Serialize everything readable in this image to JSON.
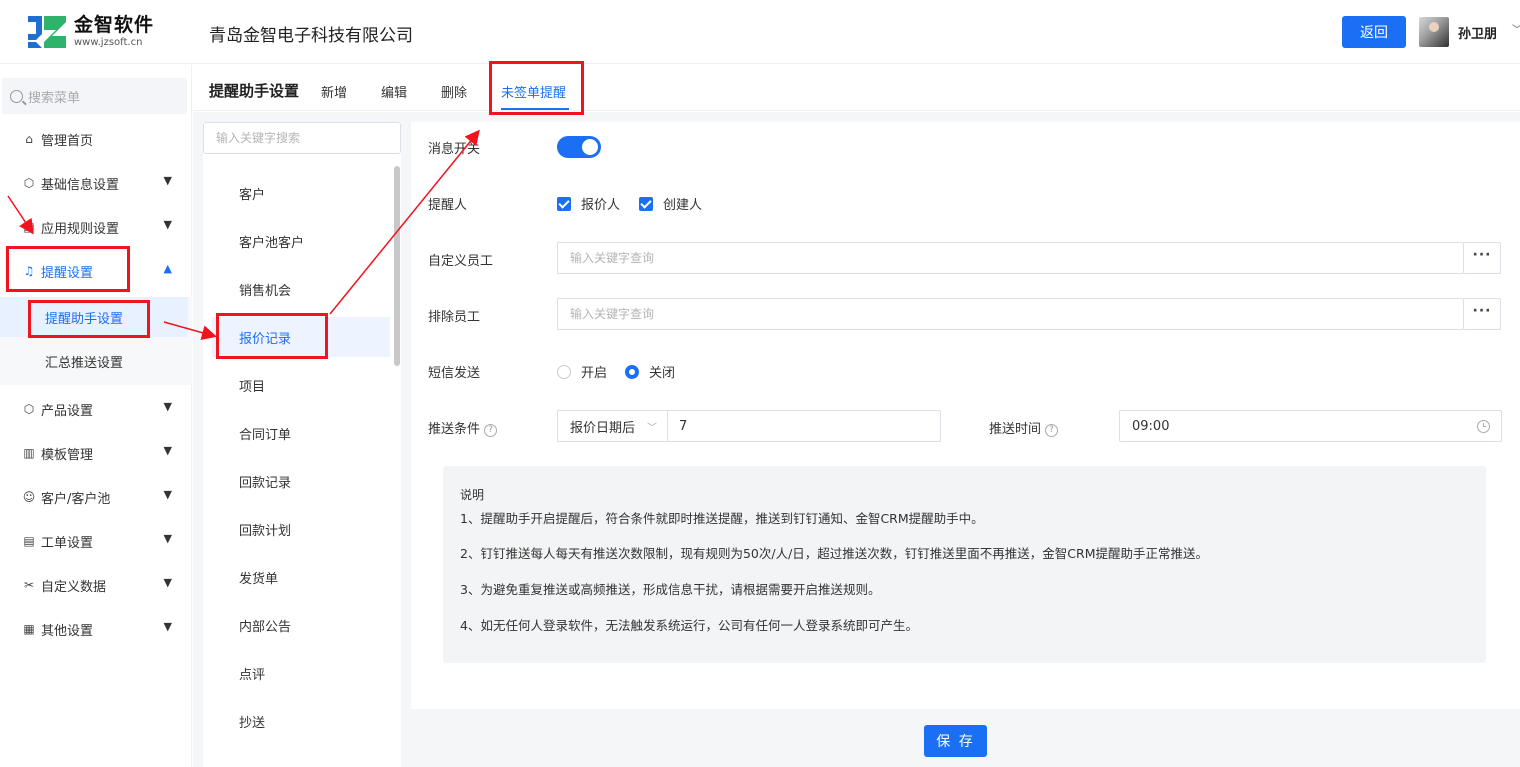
{
  "header": {
    "logo_name": "金智软件",
    "logo_url": "www.jzsoft.cn",
    "company": "青岛金智电子科技有限公司",
    "back_label": "返回",
    "username": "孙卫朋"
  },
  "sidebar": {
    "search_placeholder": "搜索菜单",
    "items": [
      {
        "label": "管理首页",
        "icon": "home-icon"
      },
      {
        "label": "基础信息设置",
        "icon": "cube-icon"
      },
      {
        "label": "应用规则设置",
        "icon": "document-icon"
      },
      {
        "label": "提醒设置",
        "icon": "bell-icon"
      },
      {
        "label": "产品设置",
        "icon": "cube-icon"
      },
      {
        "label": "模板管理",
        "icon": "columns-icon"
      },
      {
        "label": "客户/客户池",
        "icon": "users-icon"
      },
      {
        "label": "工单设置",
        "icon": "document-icon"
      },
      {
        "label": "自定义数据",
        "icon": "scissors-icon"
      },
      {
        "label": "其他设置",
        "icon": "grid-icon"
      }
    ],
    "subitems": [
      {
        "label": "提醒助手设置"
      },
      {
        "label": "汇总推送设置"
      }
    ]
  },
  "toolbar": {
    "title": "提醒助手设置",
    "new_label": "新增",
    "edit_label": "编辑",
    "delete_label": "删除",
    "unsigned_label": "未签单提醒"
  },
  "midlist": {
    "search_placeholder": "输入关键字搜索",
    "items": [
      "客户",
      "客户池客户",
      "销售机会",
      "报价记录",
      "项目",
      "合同订单",
      "回款记录",
      "回款计划",
      "发货单",
      "内部公告",
      "点评",
      "抄送"
    ]
  },
  "form": {
    "switch_label": "消息开关",
    "reminder_label": "提醒人",
    "checkbox_quoter": "报价人",
    "checkbox_creator": "创建人",
    "custom_staff_label": "自定义员工",
    "custom_staff_placeholder": "输入关键字查询",
    "exclude_staff_label": "排除员工",
    "exclude_staff_placeholder": "输入关键字查询",
    "dots": "···",
    "sms_label": "短信发送",
    "sms_on": "开启",
    "sms_off": "关闭",
    "condition_label": "推送条件",
    "condition_select": "报价日期后",
    "condition_value": "7",
    "time_label": "推送时间",
    "time_value": "09:00",
    "help_glyph": "?"
  },
  "notes": {
    "title": "说明",
    "lines": [
      "1、提醒助手开启提醒后，符合条件就即时推送提醒，推送到钉钉通知、金智CRM提醒助手中。",
      "2、钉钉推送每人每天有推送次数限制，现有规则为50次/人/日，超过推送次数，钉钉推送里面不再推送，金智CRM提醒助手正常推送。",
      "3、为避免重复推送或高频推送，形成信息干扰，请根据需要开启推送规则。",
      "4、如无任何人登录软件，无法触发系统运行，公司有任何一人登录系统即可产生。"
    ]
  },
  "save_label": "保 存",
  "colors": {
    "primary": "#1a6ff5",
    "annotation": "#f0141e",
    "logo_blue": "#1f6fd1",
    "logo_green": "#2fb36b"
  }
}
